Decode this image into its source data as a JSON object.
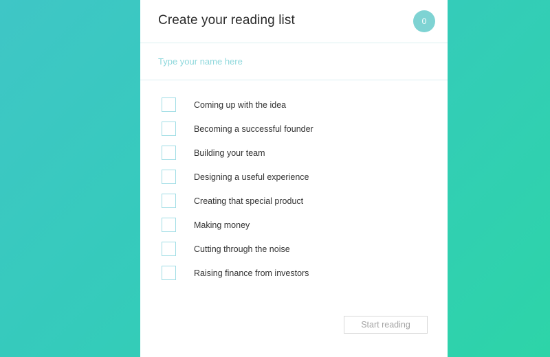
{
  "background": {
    "gradient_from": "#3fc6c6",
    "gradient_to": "#2dd4a8"
  },
  "card": {
    "header": {
      "title": "Create your reading list",
      "badge_count": "0",
      "badge_color": "#7ed3d3"
    },
    "name_field": {
      "placeholder": "Type your name here",
      "value": ""
    },
    "reading_list": {
      "items": [
        {
          "label": "Coming up with the idea",
          "checked": false
        },
        {
          "label": "Becoming a successful founder",
          "checked": false
        },
        {
          "label": "Building your team",
          "checked": false
        },
        {
          "label": "Designing a useful experience",
          "checked": false
        },
        {
          "label": "Creating that special product",
          "checked": false
        },
        {
          "label": "Making money",
          "checked": false
        },
        {
          "label": "Cutting through the noise",
          "checked": false
        },
        {
          "label": "Raising finance from investors",
          "checked": false
        }
      ]
    },
    "footer": {
      "start_button_label": "Start reading"
    }
  }
}
